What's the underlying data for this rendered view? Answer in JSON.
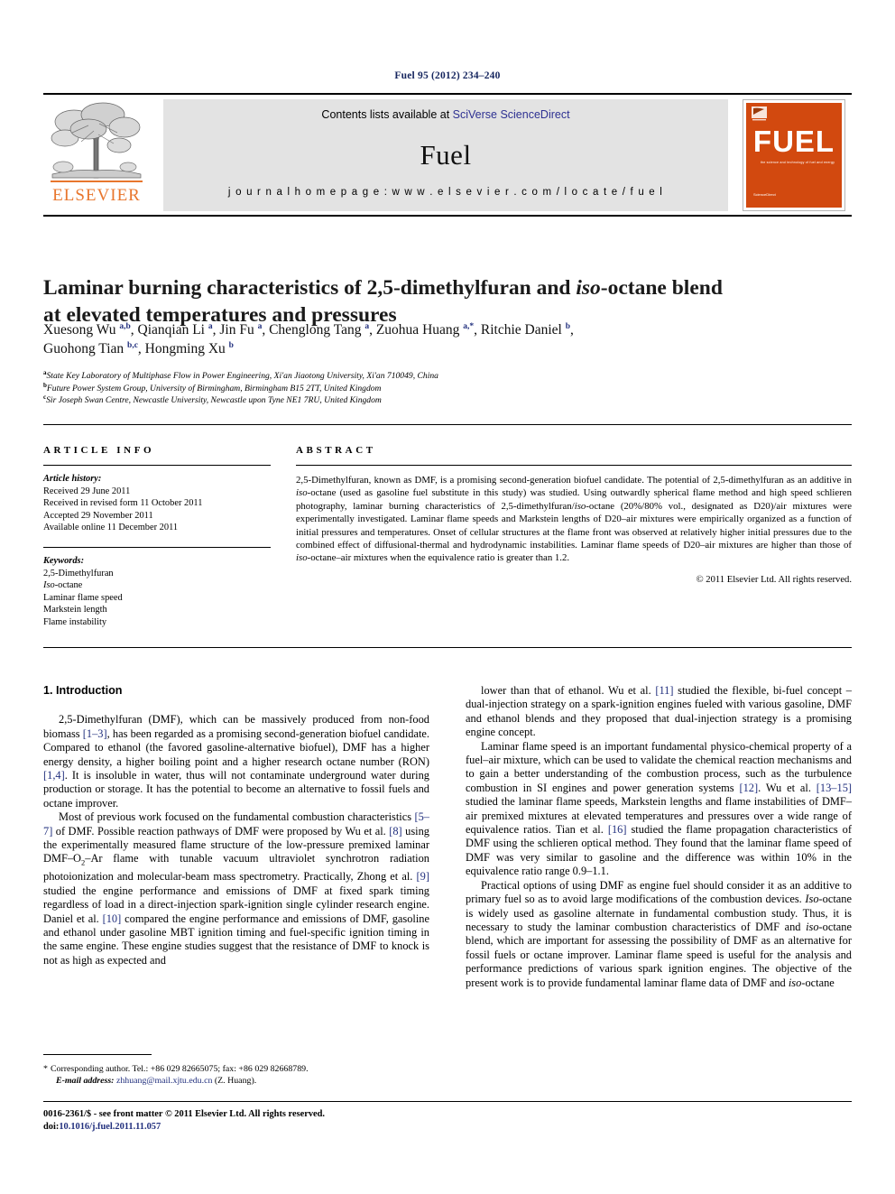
{
  "running_head": "Fuel 95 (2012) 234–240",
  "masthead": {
    "contents_prefix": "Contents lists available at ",
    "contents_link": "SciVerse ScienceDirect",
    "journal_title": "Fuel",
    "homepage": "j o u r n a l   h o m e p a g e :   w w w . e l s e v i e r . c o m / l o c a t e / f u e l",
    "publisher_logo_text": "ELSEVIER",
    "cover": {
      "title": "FUEL",
      "subtitle": "the science and technology of fuel and energy",
      "footer": "ScienceDirect"
    }
  },
  "article": {
    "title_line1_a": "Laminar burning characteristics of 2,5-dimethylfuran and ",
    "title_line1_i": "iso",
    "title_line1_b": "-octane blend",
    "title_line2": "at elevated temperatures and pressures",
    "authors": [
      {
        "name": "Xuesong Wu",
        "sup": "a,b",
        "tail": ", "
      },
      {
        "name": "Qianqian Li",
        "sup": "a",
        "tail": ", "
      },
      {
        "name": "Jin Fu",
        "sup": "a",
        "tail": ", "
      },
      {
        "name": "Chenglong Tang",
        "sup": "a",
        "tail": ", "
      },
      {
        "name": "Zuohua Huang",
        "sup": "a,*",
        "tail": ", "
      },
      {
        "name": "Ritchie Daniel",
        "sup": "b",
        "tail": ","
      },
      {
        "name": "Guohong Tian",
        "sup": "b,c",
        "tail": ", "
      },
      {
        "name": "Hongming Xu",
        "sup": "b",
        "tail": ""
      }
    ],
    "affiliations": [
      {
        "mark": "a",
        "text": "State Key Laboratory of Multiphase Flow in Power Engineering, Xi'an Jiaotong University, Xi'an 710049, China"
      },
      {
        "mark": "b",
        "text": "Future Power System Group, University of Birmingham, Birmingham B15 2TT, United Kingdom"
      },
      {
        "mark": "c",
        "text": "Sir Joseph Swan Centre, Newcastle University, Newcastle upon Tyne NE1 7RU, United Kingdom"
      }
    ]
  },
  "info": {
    "heading": "ARTICLE INFO",
    "history_label": "Article history:",
    "history": [
      "Received 29 June 2011",
      "Received in revised form 11 October 2011",
      "Accepted 29 November 2011",
      "Available online 11 December 2011"
    ],
    "keywords_label": "Keywords:",
    "keywords": [
      "2,5-Dimethylfuran",
      "Iso-octane",
      "Laminar flame speed",
      "Markstein length",
      "Flame instability"
    ]
  },
  "abstract": {
    "heading": "ABSTRACT",
    "paragraphs": [
      "2,5-Dimethylfuran, known as DMF, is a promising second-generation biofuel candidate. The potential of 2,5-dimethylfuran as an additive in iso-octane (used as gasoline fuel substitute in this study) was studied. Using outwardly spherical flame method and high speed schlieren photography, laminar burning characteristics of 2,5-dimethylfuran/iso-octane (20%/80% vol., designated as D20)/air mixtures were experimentally investigated. Laminar flame speeds and Markstein lengths of D20–air mixtures were empirically organized as a function of initial pressures and temperatures. Onset of cellular structures at the flame front was observed at relatively higher initial pressures due to the combined effect of diffusional-thermal and hydrodynamic instabilities. Laminar flame speeds of D20–air mixtures are higher than those of iso-octane–air mixtures when the equivalence ratio is greater than 1.2."
    ],
    "copyright": "© 2011 Elsevier Ltd. All rights reserved."
  },
  "body": {
    "section_heading": "1. Introduction",
    "left_paragraphs": [
      "2,5-Dimethylfuran (DMF), which can be massively produced from non-food biomass [1–3], has been regarded as a promising second-generation biofuel candidate. Compared to ethanol (the favored gasoline-alternative biofuel), DMF has a higher energy density, a higher boiling point and a higher research octane number (RON) [1,4]. It is insoluble in water, thus will not contaminate underground water during production or storage. It has the potential to become an alternative to fossil fuels and octane improver.",
      "Most of previous work focused on the fundamental combustion characteristics [5–7] of DMF. Possible reaction pathways of DMF were proposed by Wu et al. [8] using the experimentally measured flame structure of the low-pressure premixed laminar DMF–O2–Ar flame with tunable vacuum ultraviolet synchrotron radiation photoionization and molecular-beam mass spectrometry. Practically, Zhong et al. [9] studied the engine performance and emissions of DMF at fixed spark timing regardless of load in a direct-injection spark-ignition single cylinder research engine. Daniel et al. [10] compared the engine performance and emissions of DMF, gasoline and ethanol under gasoline MBT ignition timing and fuel-specific ignition timing in the same engine. These engine studies suggest that the resistance of DMF to knock is not as high as expected and"
    ],
    "right_paragraphs": [
      "lower than that of ethanol. Wu et al. [11] studied the flexible, bi-fuel concept – dual-injection strategy on a spark-ignition engines fueled with various gasoline, DMF and ethanol blends and they proposed that dual-injection strategy is a promising engine concept.",
      "Laminar flame speed is an important fundamental physico-chemical property of a fuel–air mixture, which can be used to validate the chemical reaction mechanisms and to gain a better understanding of the combustion process, such as the turbulence combustion in SI engines and power generation systems [12]. Wu et al. [13–15] studied the laminar flame speeds, Markstein lengths and flame instabilities of DMF–air premixed mixtures at elevated temperatures and pressures over a wide range of equivalence ratios. Tian et al. [16] studied the flame propagation characteristics of DMF using the schlieren optical method. They found that the laminar flame speed of DMF was very similar to gasoline and the difference was within 10% in the equivalence ratio range 0.9–1.1.",
      "Practical options of using DMF as engine fuel should consider it as an additive to primary fuel so as to avoid large modifications of the combustion devices. Iso-octane is widely used as gasoline alternate in fundamental combustion study. Thus, it is necessary to study the laminar combustion characteristics of DMF and iso-octane blend, which are important for assessing the possibility of DMF as an alternative for fossil fuels or octane improver. Laminar flame speed is useful for the analysis and performance predictions of various spark ignition engines. The objective of the present work is to provide fundamental laminar flame data of DMF and iso-octane"
    ]
  },
  "footnote": {
    "marker": "*",
    "line1": "Corresponding author. Tel.: +86 029 82665075; fax: +86 029 82668789.",
    "email_label": "E-mail address:",
    "email": "zhhuang@mail.xjtu.edu.cn",
    "email_tail": "(Z. Huang)."
  },
  "page_footer": {
    "line1": "0016-2361/$ - see front matter © 2011 Elsevier Ltd. All rights reserved.",
    "doi_label": "doi:",
    "doi_value": "10.1016/j.fuel.2011.11.057"
  },
  "colors": {
    "link_blue": "#22307e",
    "sciencedirect_blue": "#2e3192",
    "elsevier_orange": "#e8762d",
    "cover_orange": "#d2490f",
    "band_grey": "#e3e3e3"
  }
}
